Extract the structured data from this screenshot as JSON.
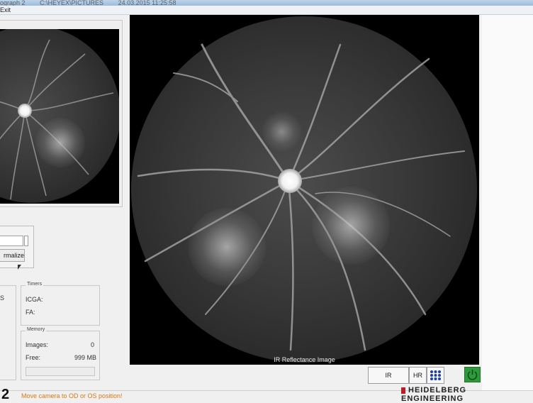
{
  "window": {
    "title_fragments": [
      "ograph 2",
      "C:\\HEYEX\\PICTURES",
      "24.03.2015 11:25:58"
    ]
  },
  "menu": {
    "exit_label": "Exit"
  },
  "main_image": {
    "caption": "IR Reflectance Image"
  },
  "normalize_panel": {
    "button_label": "rmalize"
  },
  "side_frame": {
    "letter": "S"
  },
  "timers": {
    "title": "Timers",
    "icga_label": "ICGA:",
    "fa_label": "FA:"
  },
  "memory": {
    "title": "Memory",
    "images_label": "Images:",
    "images_value": "0",
    "free_label": "Free:",
    "free_value": "999 MB"
  },
  "controls": {
    "ir_label": "IR",
    "hr_label": "HR",
    "grid_icon": "grid-icon",
    "power_icon": "power-icon"
  },
  "status": {
    "number": "2",
    "message": "Move camera to OD or OS position!"
  },
  "logo": {
    "line1": "HEIDELBERG",
    "line2": "ENGINEERING",
    "accent": "#c01a2a"
  }
}
